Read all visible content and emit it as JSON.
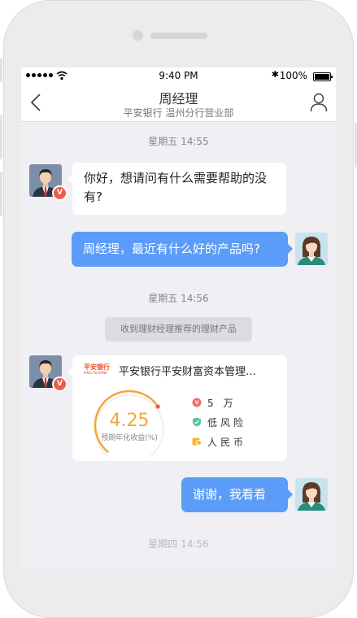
{
  "status_bar": {
    "time": "9:40 PM",
    "battery": "100%"
  },
  "nav": {
    "title": "周经理",
    "subtitle": "平安银行 温州分行营业部"
  },
  "messages": {
    "time1": "星期五 14:55",
    "m1": "你好，想请问有什么需要帮助的没有?",
    "m2": "周经理，最近有什么好的产品吗?",
    "time2": "星期五 14:56",
    "notice": "收到理财经理推荐的理财产品",
    "time3": "星期四 14:56",
    "m3": "谢谢，我看看"
  },
  "product_card": {
    "logo_cn": "平安银行",
    "logo_en": "PING AN BANK",
    "title": "平安银行平安财富资本管理…",
    "rate": "4.25",
    "rate_label": "预期年化收益(%)",
    "rate_fraction": 0.7,
    "features": [
      "5 万",
      "低风险",
      "人民币"
    ]
  },
  "colors": {
    "accent_blue": "#5b9cf8",
    "rate_orange": "#f3a73a",
    "brand_red": "#e9502b"
  }
}
